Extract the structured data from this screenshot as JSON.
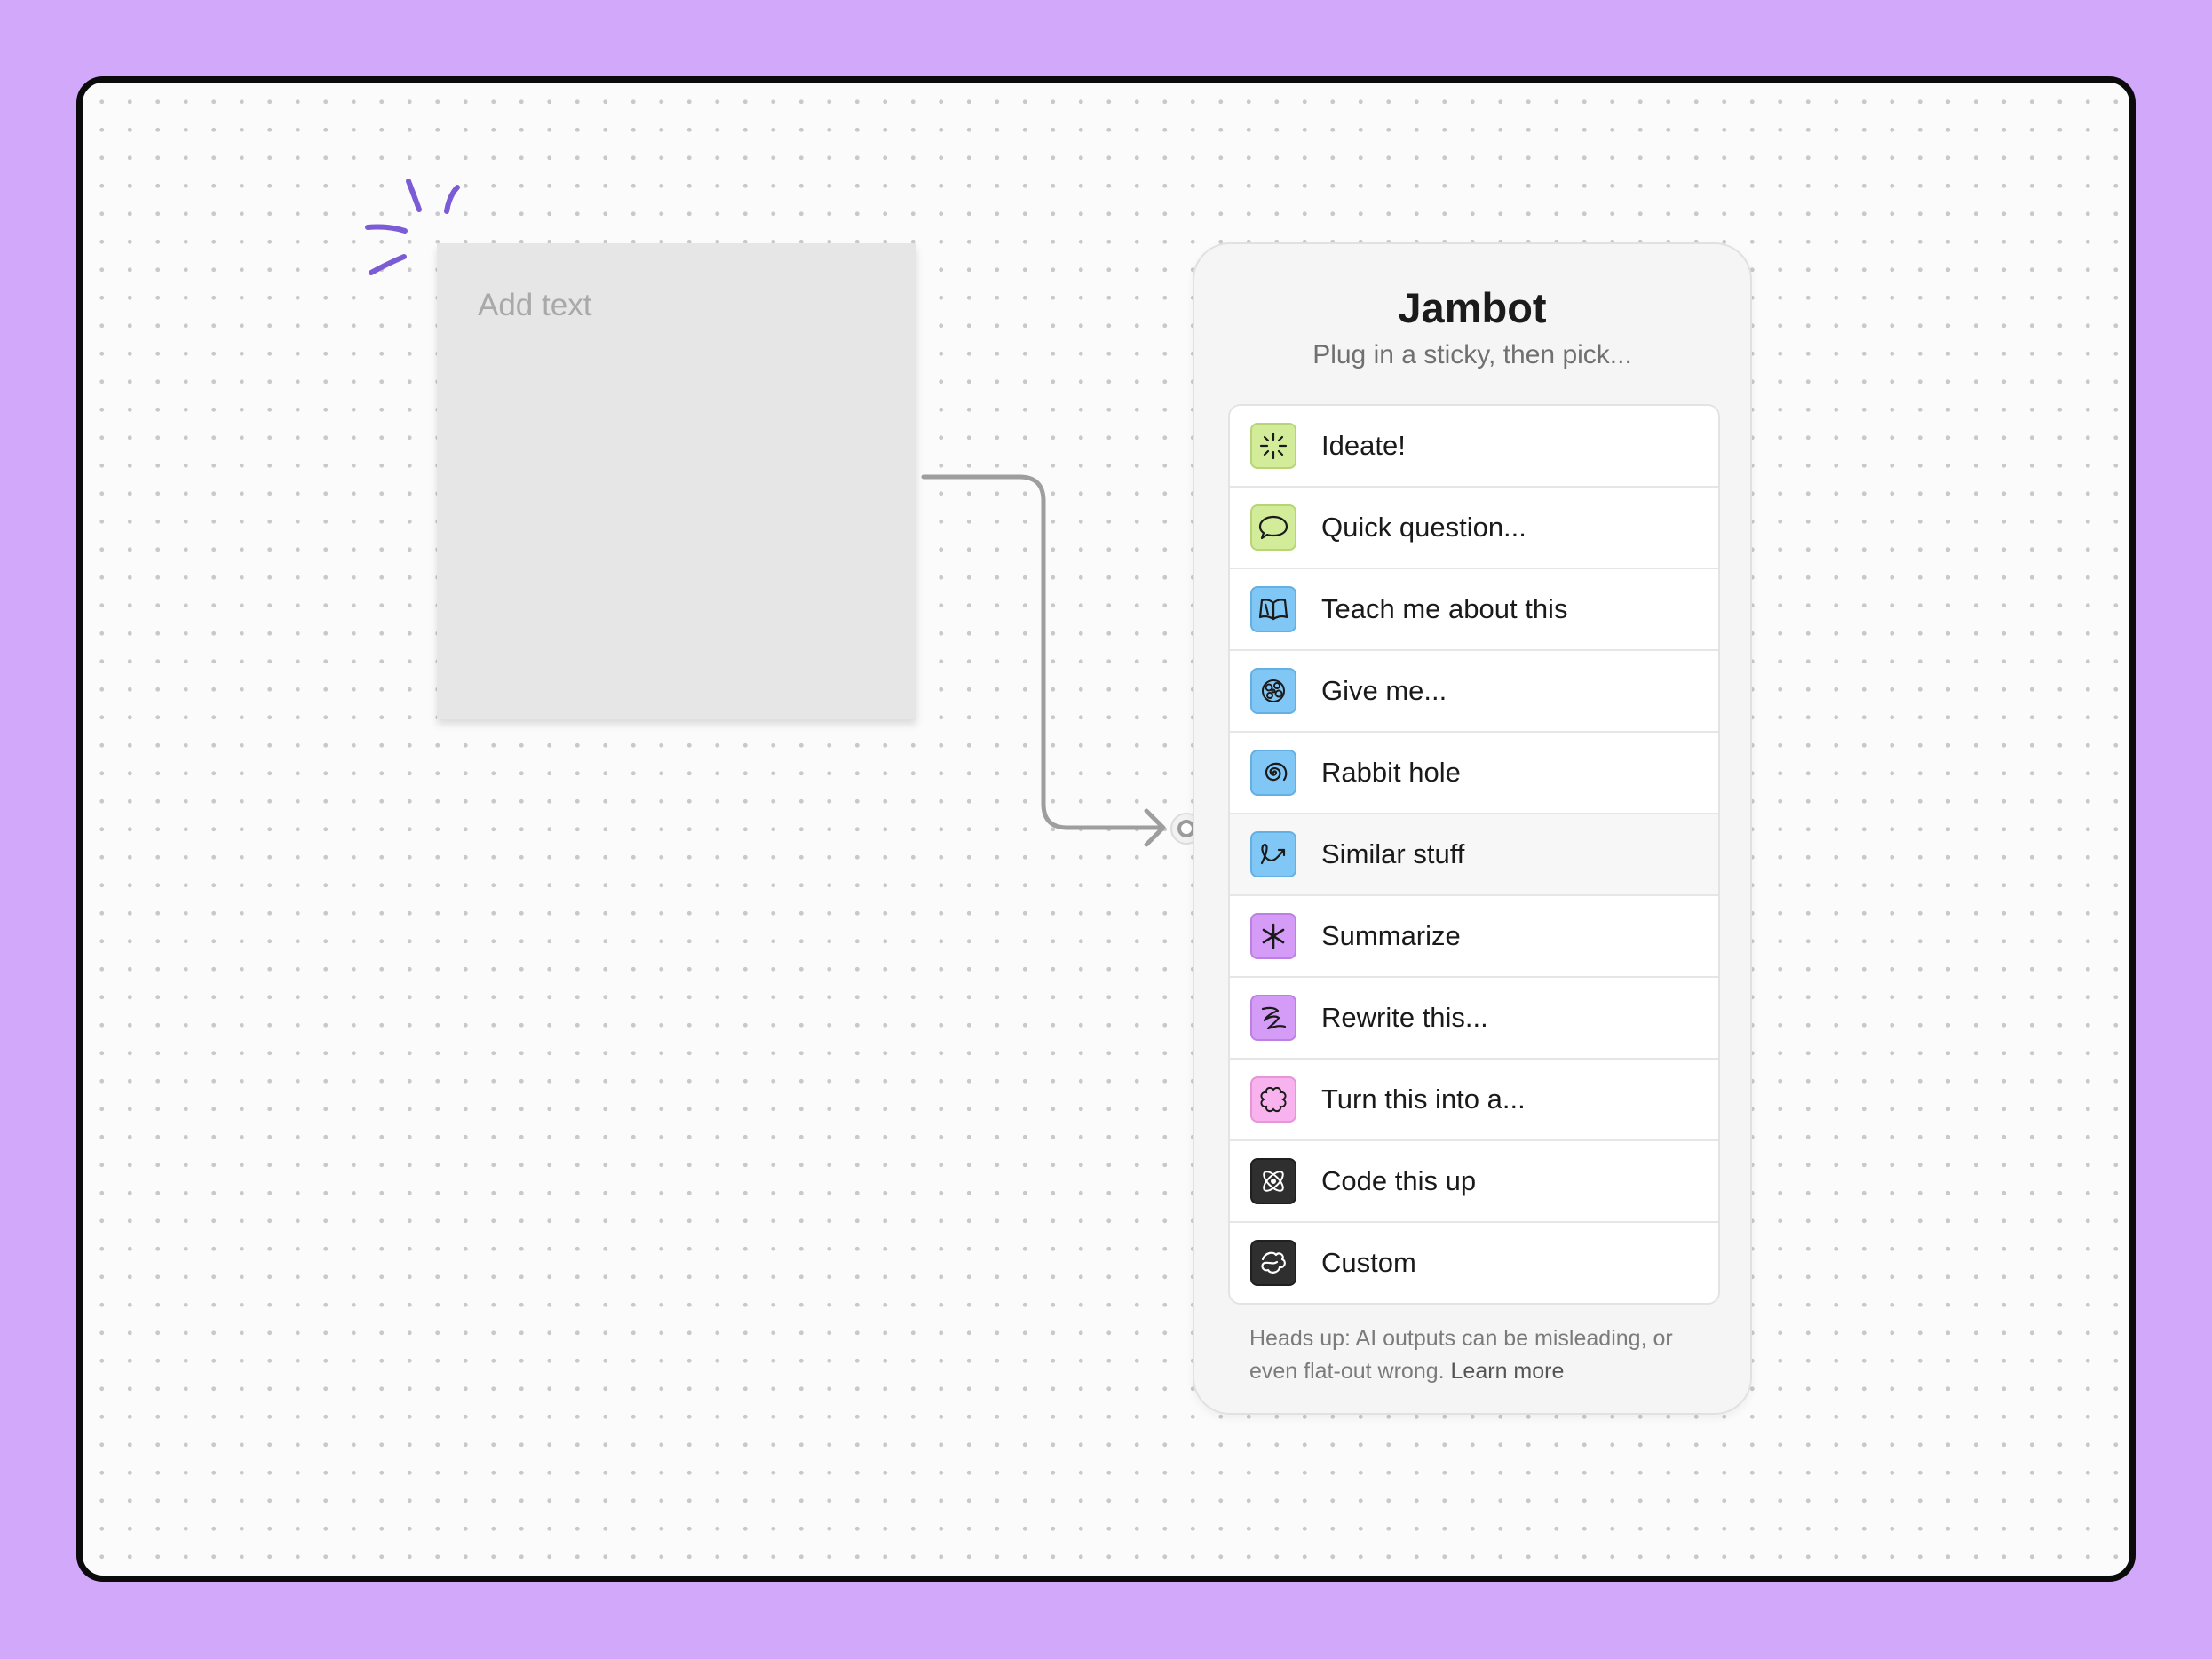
{
  "canvas": {
    "background_color": "#d2a8fb",
    "frame_color": "#0b0b0b"
  },
  "sticky": {
    "placeholder": "Add text",
    "color": "#e6e6e6"
  },
  "sparkle": {
    "icon": "sparkle-burst-icon",
    "color": "#7b5cd6"
  },
  "connector": {
    "color": "#9e9e9e",
    "icon": "connector-arrow-icon"
  },
  "jambot": {
    "title": "Jambot",
    "subtitle": "Plug in a sticky, then pick...",
    "items": [
      {
        "label": "Ideate!",
        "icon": "sparkle-icon",
        "color": "#d3ec99"
      },
      {
        "label": "Quick question...",
        "icon": "speech-bubble-icon",
        "color": "#d3ec99"
      },
      {
        "label": "Teach me about this",
        "icon": "open-book-icon",
        "color": "#80c7f5"
      },
      {
        "label": "Give me...",
        "icon": "brain-icon",
        "color": "#80c7f5"
      },
      {
        "label": "Rabbit hole",
        "icon": "spiral-icon",
        "color": "#80c7f5"
      },
      {
        "label": "Similar stuff",
        "icon": "loop-arrow-icon",
        "color": "#80c7f5"
      },
      {
        "label": "Summarize",
        "icon": "asterisk-icon",
        "color": "#d59cf7"
      },
      {
        "label": "Rewrite this...",
        "icon": "scribble-icon",
        "color": "#d59cf7"
      },
      {
        "label": "Turn this into a...",
        "icon": "flower-icon",
        "color": "#f8b3ee"
      },
      {
        "label": "Code this up",
        "icon": "atom-icon",
        "color": "#2f2f2f"
      },
      {
        "label": "Custom",
        "icon": "squiggle-icon",
        "color": "#2f2f2f"
      }
    ],
    "disclaimer": "Heads up: AI outputs can be misleading, or even flat-out wrong.",
    "learn_more": "Learn more"
  }
}
